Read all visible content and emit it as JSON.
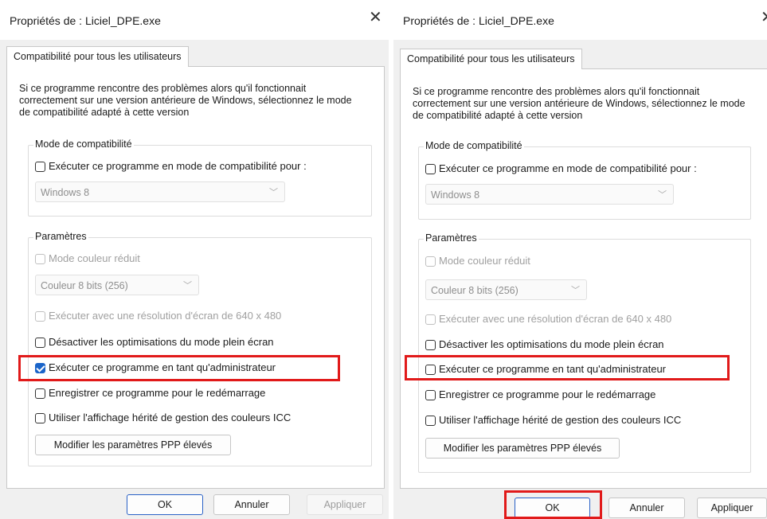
{
  "dialog_title": "Propriétés de : Liciel_DPE.exe",
  "close_glyph": "✕",
  "tab_label": "Compatibilité pour tous les utilisateurs",
  "intro_text": "Si ce programme rencontre des problèmes alors qu'il fonctionnait correctement sur une version antérieure de Windows, sélectionnez le mode de compatibilité adapté à cette version",
  "compat_group": {
    "title": "Mode de compatibilité",
    "run_in_compat_label": "Exécuter ce programme en mode de compatibilité pour :",
    "os_select_value": "Windows 8"
  },
  "settings_group": {
    "title": "Paramètres",
    "reduced_color_label": "Mode couleur réduit",
    "color_select_value": "Couleur 8 bits (256)",
    "resolution_label": "Exécuter avec une résolution d'écran de 640 x 480",
    "fullscreen_opt_label": "Désactiver les optimisations du mode plein écran",
    "run_as_admin_label": "Exécuter ce programme en tant qu'administrateur",
    "register_restart_label": "Enregistrer ce programme pour le redémarrage",
    "legacy_icc_label": "Utiliser l'affichage hérité de gestion des couleurs ICC",
    "dpi_button_label": "Modifier les paramètres PPP élevés"
  },
  "buttons": {
    "ok": "OK",
    "cancel": "Annuler",
    "apply": "Appliquer"
  },
  "left_state": {
    "run_as_admin_checked": true
  },
  "right_state": {
    "run_as_admin_checked": false
  },
  "colors": {
    "highlight": "#e11a1a",
    "checkbox_accent": "#1a64c9"
  }
}
